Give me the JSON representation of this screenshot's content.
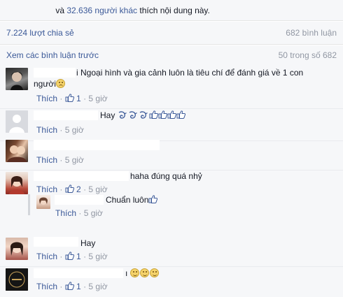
{
  "summary": {
    "likes_conj": "và",
    "likes_count": "32.636 người khác",
    "likes_suffix": "thích nội dung này.",
    "shares": "7.224 lượt chia sẻ",
    "comments_count": "682 bình luận"
  },
  "pagination": {
    "view_previous": "Xem các bình luận trước",
    "page_count": "50 trong số 682"
  },
  "actions": {
    "like_label": "Thích",
    "separator": "·"
  },
  "comments": [
    {
      "text_line1": "i Ngoại hình và gia cảnh luôn là tiêu chí để đánh giá về 1 con",
      "text_line2": "người",
      "likes": "1",
      "time": "5 giờ"
    },
    {
      "text": "Hay",
      "time": "5 giờ"
    },
    {
      "time": "5 giờ"
    },
    {
      "text": "haha đúng quá nhỷ",
      "likes": "2",
      "time": "5 giờ",
      "reply": {
        "text": "Chuẩn luôn",
        "time": "5 giờ"
      }
    },
    {
      "text": "Hay",
      "likes": "1",
      "time": "5 giờ"
    },
    {
      "text": "ı",
      "likes": "1",
      "time": "5 giờ"
    }
  ],
  "colors": {
    "link": "#3b5998",
    "muted": "#9197a3",
    "panel": "#f6f7f9"
  }
}
